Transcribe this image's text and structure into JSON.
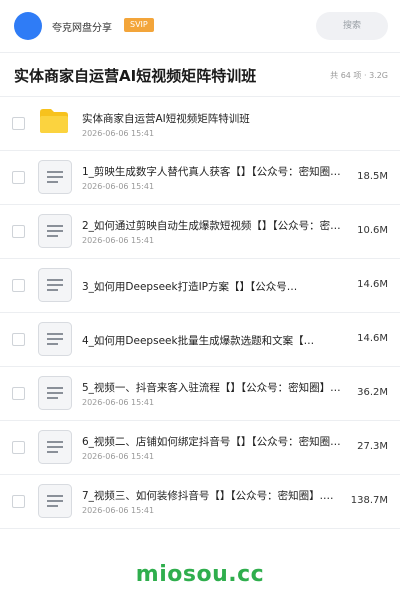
{
  "topbar": {
    "username": "夸克网盘分享",
    "badge": "SVIP",
    "search_placeholder": "搜索"
  },
  "share": {
    "title": "实体商家自运营AI短视频矩阵特训班",
    "meta": "共 64 项 · 3.2G"
  },
  "folder_row": {
    "name": "实体商家自运营AI短视频矩阵特训班",
    "date": "2026-06-06 15:41"
  },
  "files": [
    {
      "name": "1_剪映生成数字人替代真人获客【】【公众号：密知圈…",
      "date": "2026-06-06 15:41",
      "size": "18.5M"
    },
    {
      "name": "2_如何通过剪映自动生成爆款短视频【】【公众号：密…",
      "date": "2026-06-06 15:41",
      "size": "10.6M"
    },
    {
      "name": "3_如何用Deepseek打造IP方案【】【公众号…",
      "date": "",
      "size": "14.6M"
    },
    {
      "name": "4_如何用Deepseek批量生成爆款选题和文案【…",
      "date": "",
      "size": "14.6M"
    },
    {
      "name": "5_视频一、抖音来客入驻流程【】【公众号：密知圈】…",
      "date": "2026-06-06 15:41",
      "size": "36.2M"
    },
    {
      "name": "6_视频二、店铺如何绑定抖音号【】【公众号：密知圈…",
      "date": "2026-06-06 15:41",
      "size": "27.3M"
    },
    {
      "name": "7_视频三、如何装修抖音号【】【公众号：密知圈】.…",
      "date": "2026-06-06 15:41",
      "size": "138.7M"
    }
  ],
  "watermark": "miosou.cc",
  "colors": {
    "accent": "#2f7cf6",
    "svip": "#f3a53a",
    "folder": "#f7c21d",
    "watermark": "#2fae4d"
  }
}
